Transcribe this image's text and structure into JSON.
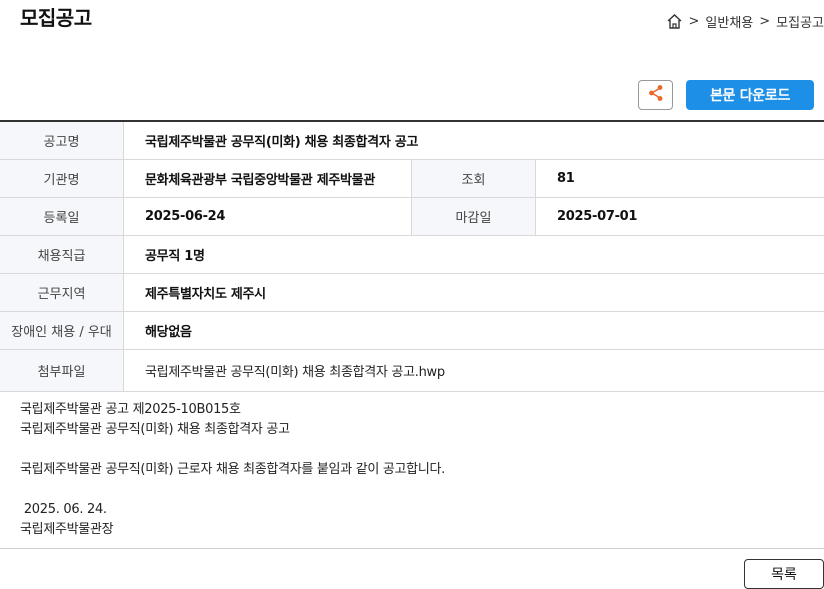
{
  "page": {
    "title": "모집공고"
  },
  "breadcrumb": {
    "items": [
      "일반채용",
      "모집공고"
    ],
    "separator": ">"
  },
  "actions": {
    "download_label": "본문 다운로드",
    "list_label": "목록"
  },
  "colors": {
    "accent": "#1e8fe6",
    "share_icon": "#e8692a"
  },
  "notice": {
    "title_label": "공고명",
    "title": "국립제주박물관 공무직(미화) 채용 최종합격자 공고",
    "agency_label": "기관명",
    "agency": "문화체육관광부 국립중앙박물관 제주박물관",
    "views_label": "조회",
    "views": "81",
    "registered_label": "등록일",
    "registered": "2025-06-24",
    "deadline_label": "마감일",
    "deadline": "2025-07-01",
    "position_label": "채용직급",
    "position": "공무직 1명",
    "region_label": "근무지역",
    "region": "제주특별자치도 제주시",
    "disability_label": "장애인 채용 / 우대",
    "disability": "해당없음",
    "attachment_label": "첨부파일",
    "attachment": "국립제주박물관 공무직(미화) 채용 최종합격자 공고.hwp"
  },
  "body": {
    "line1": "국립제주박물관 공고 제2025-10B015호",
    "line2": "국립제주박물관 공무직(미화) 채용 최종합격자 공고",
    "line3": "국립제주박물관 공무직(미화) 근로자 채용 최종합격자를 붙임과 같이 공고합니다.",
    "date": " 2025. 06. 24.",
    "signer": "국립제주박물관장"
  }
}
